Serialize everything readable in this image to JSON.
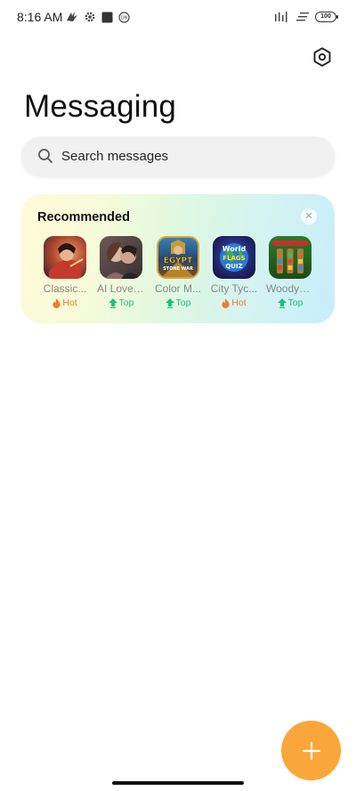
{
  "status_bar": {
    "time": "8:16 AM",
    "battery": "100"
  },
  "header": {
    "title": "Messaging"
  },
  "search": {
    "placeholder": "Search messages"
  },
  "recommended": {
    "title": "Recommended",
    "apps": [
      {
        "name": "Classic...",
        "badge": "Hot",
        "badge_type": "hot",
        "icon": "classic-game-icon"
      },
      {
        "name": "AI Lover ...",
        "badge": "Top",
        "badge_type": "top",
        "icon": "ai-lover-icon"
      },
      {
        "name": "Color M...",
        "badge": "Top",
        "badge_type": "top",
        "icon": "egypt-stone-war-icon",
        "icon_text_1": "EGYPT",
        "icon_text_2": "STONE WAR"
      },
      {
        "name": "City Tyc...",
        "badge": "Hot",
        "badge_type": "hot",
        "icon": "world-flags-quiz-icon",
        "icon_text_1": "World",
        "icon_text_2": "FLAGS",
        "icon_text_3": "QUIZ"
      },
      {
        "name": "WoodyS...",
        "badge": "Top",
        "badge_type": "top",
        "icon": "woody-sort-icon"
      }
    ]
  },
  "colors": {
    "hot": "#f07a2a",
    "top": "#1fbf7a",
    "fab": "#fba63a"
  }
}
